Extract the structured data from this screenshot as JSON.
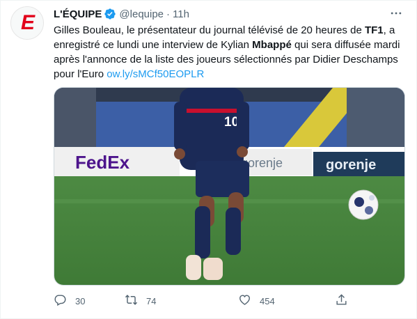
{
  "account": {
    "name": "L'ÉQUIPE",
    "handle": "@lequipe",
    "separator": "·",
    "time": "11h",
    "avatar_letter": "E",
    "verified": true
  },
  "tweet": {
    "text_parts": [
      {
        "t": "Gilles Bouleau, le présentateur du journal télévisé de 20 heures de ",
        "style": "normal"
      },
      {
        "t": "TF1",
        "style": "bold"
      },
      {
        "t": ", a enregistré ce lundi une interview de Kylian ",
        "style": "normal"
      },
      {
        "t": "Mbappé",
        "style": "bold"
      },
      {
        "t": " qui sera diffusée mardi après l'annonce de la liste des joueurs sélectionnés par Didier Deschamps pour l'Euro ",
        "style": "normal"
      },
      {
        "t": "ow.ly/sMCf50EOPLR",
        "style": "link"
      }
    ]
  },
  "media": {
    "jersey_number": "10",
    "board_brands": [
      "FedEx",
      "gorenje",
      "gorenje"
    ]
  },
  "actions": {
    "reply_count": "30",
    "retweet_count": "74",
    "like_count": "454"
  },
  "icons": {
    "more": "more-icon",
    "reply": "reply-icon",
    "retweet": "retweet-icon",
    "like": "heart-icon",
    "share": "share-icon",
    "verified": "verified-badge-icon"
  },
  "colors": {
    "link": "#1d9bf0",
    "muted": "#536471",
    "verified": "#1d9bf0",
    "brand_red": "#e2001a"
  }
}
